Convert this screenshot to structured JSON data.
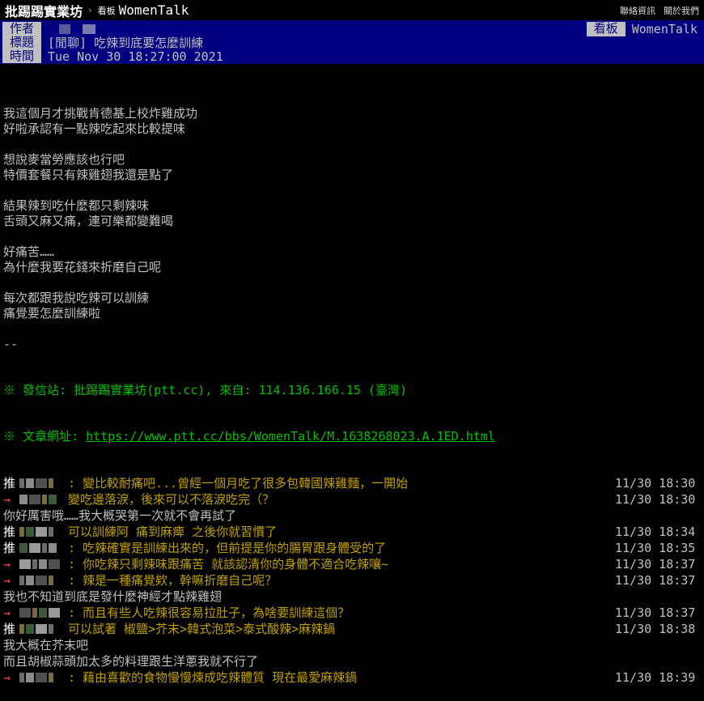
{
  "topbar": {
    "board_name": "批踢踢實業坊",
    "crumb_label": "看板",
    "crumb_board": "WomenTalk",
    "links": [
      "聯絡資訊",
      "關於我們"
    ]
  },
  "meta": {
    "author_label": "作者",
    "title_label": "標題",
    "time_label": "時間",
    "board_label": "看板",
    "board_value": "WomenTalk",
    "title_value": "[閒聊] 吃辣到底要怎麼訓練",
    "time_value": "Tue Nov 30 18:27:00 2021"
  },
  "body_lines": [
    "我這個月才挑戰肯德基上校炸雞成功",
    "好啦承認有一點辣吃起來比較提味",
    "",
    "想說麥當勞應該也行吧",
    "特價套餐只有辣雞翅我還是點了",
    "",
    "結果辣到吃什麼都只剩辣味",
    "舌頭又麻又痛，連可樂都變難喝",
    "",
    "好痛苦……",
    "為什麼我要花錢來折磨自己呢",
    "",
    "每次都跟我說吃辣可以訓練",
    "痛覺要怎麼訓練啦",
    "",
    "--"
  ],
  "footer": {
    "origin": "※ 發信站: 批踢踢實業坊(ptt.cc), 來自: 114.136.166.15 (臺灣)",
    "url_label": "※ 文章網址: ",
    "url": "https://www.ptt.cc/bbs/WomenTalk/M.1638268023.A.1ED.html"
  },
  "comments": [
    {
      "type": "push",
      "tag": "推",
      "text": ": 變比較耐痛吧...曾經一個月吃了很多包韓國辣雞麵，一開始",
      "time": "11/30 18:30"
    },
    {
      "type": "push",
      "tag": "→",
      "text": "變吃邊落淚，後來可以不落淚吃完（？",
      "time": "11/30 18:30"
    },
    {
      "type": "plain",
      "text": "你好厲害哦……我大概哭第一次就不會再試了"
    },
    {
      "type": "push",
      "tag": "推",
      "text": "可以訓練阿 痛到麻痺 之後你就習慣了",
      "time": "11/30 18:34"
    },
    {
      "type": "push",
      "tag": "推",
      "text": ": 吃辣確實是訓練出來的，但前提是你的腸胃跟身體受的了",
      "time": "11/30 18:35"
    },
    {
      "type": "push",
      "tag": "→",
      "text": ": 你吃辣只剩辣味跟痛苦 就該認清你的身體不適合吃辣嚷~",
      "time": "11/30 18:37"
    },
    {
      "type": "push",
      "tag": "→",
      "text": ": 辣是一種痛覺欸，幹嘛折磨自己呢？",
      "time": "11/30 18:37"
    },
    {
      "type": "plain",
      "text": "我也不知道到底是發什麼神經才點辣雞翅"
    },
    {
      "type": "push",
      "tag": "→",
      "text": ": 而且有些人吃辣很容易拉肚子，為啥要訓練這個？",
      "time": "11/30 18:37"
    },
    {
      "type": "push",
      "tag": "推",
      "text": "可以試著 椒鹽>芥末>韓式泡菜>泰式酸辣>麻辣鍋",
      "time": "11/30 18:38"
    },
    {
      "type": "plain",
      "text": "我大概在芥末吧"
    },
    {
      "type": "plain",
      "text": "而且胡椒蒜頭加太多的料理跟生洋蔥我就不行了"
    },
    {
      "type": "push",
      "tag": "→",
      "text": ": 藉由喜歡的食物慢慢煉成吃辣體質 現在最愛麻辣鍋",
      "time": "11/30 18:39"
    }
  ]
}
